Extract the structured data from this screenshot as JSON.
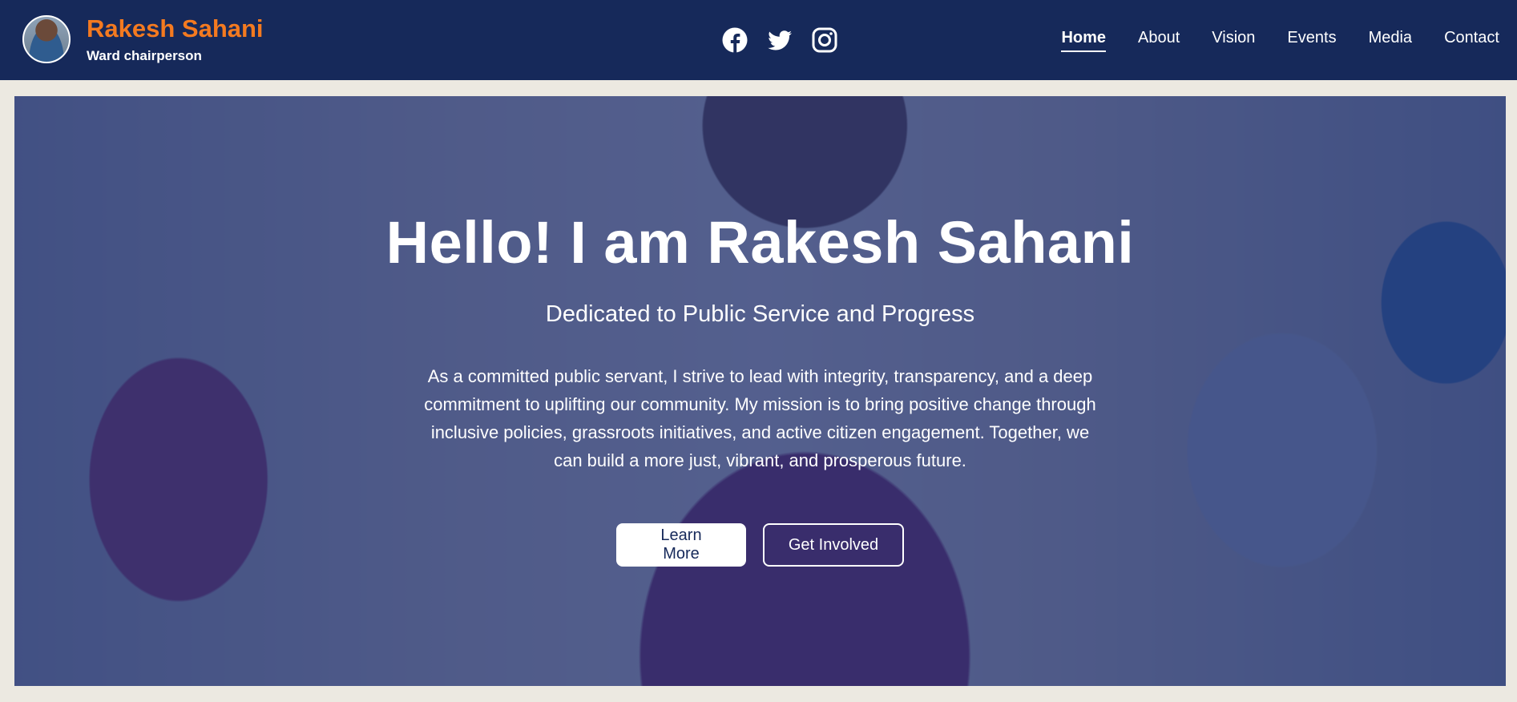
{
  "header": {
    "name": "Rakesh Sahani",
    "role": "Ward chairperson",
    "avatar_icon": "profile-photo",
    "socials": [
      {
        "icon": "facebook-icon"
      },
      {
        "icon": "twitter-icon"
      },
      {
        "icon": "instagram-icon"
      }
    ],
    "nav": [
      "Home",
      "About",
      "Vision",
      "Events",
      "Media",
      "Contact"
    ],
    "active_nav": "Home"
  },
  "hero": {
    "title": "Hello! I am Rakesh Sahani",
    "subtitle": "Dedicated to Public Service and Progress",
    "text": "As a committed public servant, I strive to lead with integrity, transparency, and a deep commitment to uplifting our community. My mission is to bring positive change through inclusive policies, grassroots initiatives, and active citizen engagement. Together, we can build a more just, vibrant, and prosperous future.",
    "primary_button": "Learn More",
    "secondary_button": "Get Involved"
  },
  "colors": {
    "header_bg": "#16295a",
    "brand_accent": "#f47a20",
    "page_bg": "#ece9e1"
  }
}
